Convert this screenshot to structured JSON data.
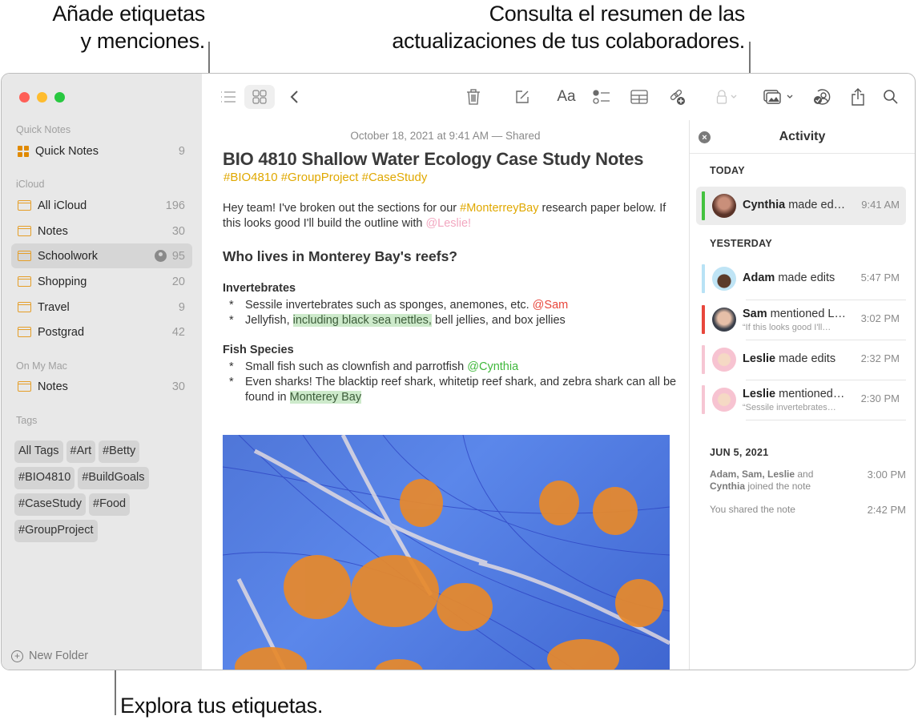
{
  "callouts": {
    "tags_mentions": [
      "Añade etiquetas",
      "y menciones."
    ],
    "activity_summary": [
      "Consulta el resumen de las",
      "actualizaciones de tus colaboradores."
    ],
    "browse_tags": "Explora tus etiquetas."
  },
  "window_controls": {
    "close": "#fe5f57",
    "minimize": "#febc2e",
    "zoom": "#28c840"
  },
  "sidebar": {
    "sections": [
      {
        "header": "Quick Notes",
        "items": [
          {
            "icon": "quick-notes-grid-icon",
            "label": "Quick Notes",
            "count": "9"
          }
        ]
      },
      {
        "header": "iCloud",
        "items": [
          {
            "icon": "folder-icon",
            "label": "All iCloud",
            "count": "196"
          },
          {
            "icon": "folder-icon",
            "label": "Notes",
            "count": "30"
          },
          {
            "icon": "folder-icon",
            "label": "Schoolwork",
            "count": "95",
            "shared": true,
            "selected": true
          },
          {
            "icon": "folder-icon",
            "label": "Shopping",
            "count": "20"
          },
          {
            "icon": "folder-icon",
            "label": "Travel",
            "count": "9"
          },
          {
            "icon": "folder-icon",
            "label": "Postgrad",
            "count": "42"
          }
        ]
      },
      {
        "header": "On My Mac",
        "items": [
          {
            "icon": "folder-icon",
            "label": "Notes",
            "count": "30"
          }
        ]
      }
    ],
    "tags_header": "Tags",
    "tags": [
      "All Tags",
      "#Art",
      "#Betty",
      "#BIO4810",
      "#BuildGoals",
      "#CaseStudy",
      "#Food",
      "#GroupProject"
    ],
    "new_folder": "New Folder"
  },
  "toolbar": {
    "items": [
      "list-view-icon",
      "gallery-view-icon",
      "back-chevron-icon",
      "trash-icon",
      "compose-icon",
      "format-text-icon",
      "checklist-icon",
      "table-icon",
      "collaborate-link-icon",
      "lock-icon",
      "media-icon",
      "activity-collaborators-icon",
      "share-icon",
      "search-icon"
    ],
    "format_label": "Aa"
  },
  "note": {
    "date": "October 18, 2021 at 9:41 AM — Shared",
    "title": "BIO 4810 Shallow Water Ecology Case Study Notes",
    "hashtags": "#BIO4810 #GroupProject #CaseStudy",
    "intro": {
      "before": "Hey team! I've broken out the sections for our ",
      "tag": "#MonterreyBay",
      "middle": " research paper below. If this looks good I'll build the outline with ",
      "mention": "@Leslie!"
    },
    "heading": "Who lives in Monterey Bay's reefs?",
    "sections": [
      {
        "title": "Invertebrates",
        "items": [
          {
            "text": "Sessile invertebrates such as sponges, anemones, etc. ",
            "mention": "@Sam"
          },
          {
            "before": "Jellyfish, ",
            "highlight": "including black sea nettles,",
            "after": " bell jellies, and box jellies"
          }
        ]
      },
      {
        "title": "Fish Species",
        "items": [
          {
            "text": "Small fish such as clownfish and parrotfish ",
            "mention": "@Cynthia"
          },
          {
            "before": "Even sharks! The blacktip reef shark, whitetip reef shark, and zebra shark can all be found in ",
            "highlight": "Monterey Bay"
          }
        ]
      }
    ],
    "bullet": "*",
    "image": "jellyfish-photo"
  },
  "activity": {
    "title": "Activity",
    "groups": [
      {
        "label": "TODAY",
        "entries": [
          {
            "name": "Cynthia",
            "action": " made ed…",
            "time": "9:41 AM",
            "color": "#44c23f",
            "selected": true
          }
        ]
      },
      {
        "label": "YESTERDAY",
        "entries": [
          {
            "name": "Adam",
            "action": " made edits",
            "time": "5:47 PM",
            "color": "#b8e2f5"
          },
          {
            "name": "Sam",
            "action": " mentioned L…",
            "sub": "“If this looks good I'll…",
            "time": "3:02 PM",
            "color": "#e8473c"
          },
          {
            "name": "Leslie",
            "action": " made edits",
            "time": "2:32 PM",
            "color": "#f6c6d3"
          },
          {
            "name": "Leslie",
            "action": " mentioned…",
            "sub": "“Sessile invertebrates…",
            "time": "2:30 PM",
            "color": "#f6c6d3"
          }
        ]
      },
      {
        "label": "JUN 5, 2021",
        "entries": [
          {
            "names": "Adam, Sam, Leslie",
            "joiner": " and ",
            "last": "Cynthia",
            "action": " joined the note",
            "time": "3:00 PM"
          },
          {
            "text": "You shared the note",
            "time": "2:42 PM"
          }
        ]
      }
    ]
  }
}
